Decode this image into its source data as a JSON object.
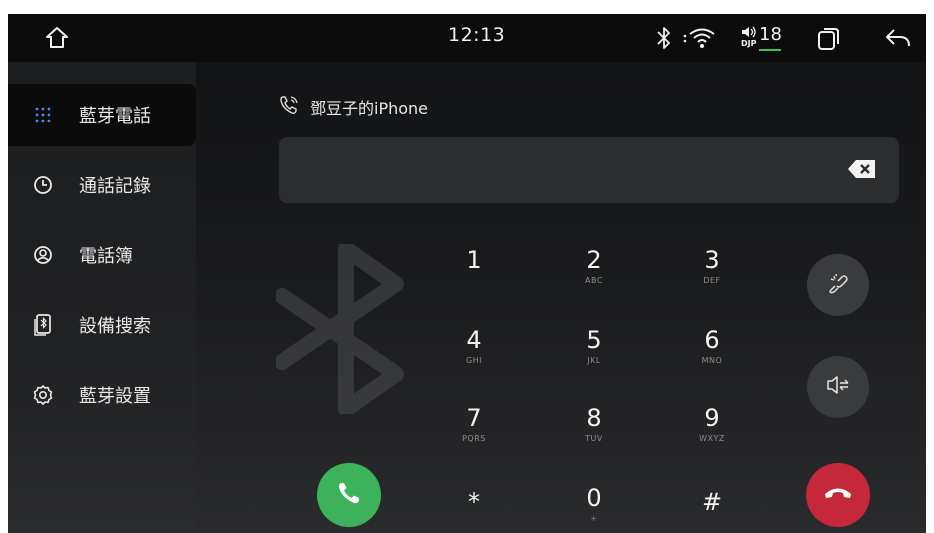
{
  "status_bar": {
    "time": "12:13",
    "dfp_label": "DJP",
    "volume": "18"
  },
  "sidebar": {
    "items": [
      {
        "label": "藍芽電話",
        "icon": "dialpad-icon",
        "active": true
      },
      {
        "label": "通話記錄",
        "icon": "clock-icon",
        "active": false
      },
      {
        "label": "電話簿",
        "icon": "contact-icon",
        "active": false
      },
      {
        "label": "設備搜索",
        "icon": "device-search-icon",
        "active": false
      },
      {
        "label": "藍芽設置",
        "icon": "gear-icon",
        "active": false
      }
    ]
  },
  "device": {
    "name": "鄧豆子的iPhone"
  },
  "input": {
    "value": ""
  },
  "keypad": [
    {
      "num": "1",
      "sub": ""
    },
    {
      "num": "2",
      "sub": "ABC"
    },
    {
      "num": "3",
      "sub": "DEF"
    },
    {
      "num": "4",
      "sub": "GHI"
    },
    {
      "num": "5",
      "sub": "JKL"
    },
    {
      "num": "6",
      "sub": "MNO"
    },
    {
      "num": "7",
      "sub": "PQRS"
    },
    {
      "num": "8",
      "sub": "TUV"
    },
    {
      "num": "9",
      "sub": "WXYZ"
    },
    {
      "num": "*",
      "sub": ""
    },
    {
      "num": "0",
      "sub": "+"
    },
    {
      "num": "#",
      "sub": ""
    }
  ],
  "colors": {
    "call_green": "#3cb35a",
    "hangup_red": "#c5283b",
    "accent_blue": "#3b8df0",
    "volume_green": "#3fc05a"
  }
}
